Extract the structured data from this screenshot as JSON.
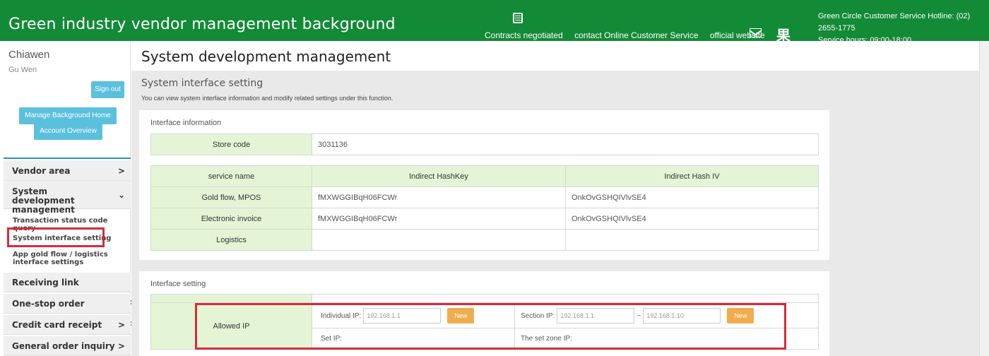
{
  "header": {
    "brand": "Green industry vendor management background",
    "nav": [
      "Contracts negotiated",
      "contact Online Customer Service",
      "official website"
    ],
    "hotline": "Green Circle Customer Service Hotline: (02) 2655-1775",
    "hours": "Service hours: 09:00-18:00",
    "glyph": "果",
    "icons": [
      "calendar-icon",
      "mail-icon"
    ],
    "bg_color": "#138a36"
  },
  "sidebar": {
    "user": "Chiawen",
    "user_sub": "Gu Wen",
    "sign_out": "Sign out",
    "manage_home": "Manage Background Home",
    "account_overview": "Account Overview",
    "menu": [
      {
        "label": "Vendor area",
        "chev": ">"
      },
      {
        "label": "System development management",
        "chev": "⌄"
      },
      {
        "label": "Receiving link management",
        "chev": ">"
      },
      {
        "label": "One-stop order management",
        "chev": ">"
      },
      {
        "label": "Credit card receipt",
        "chev": ">"
      },
      {
        "label": "General order inquiry",
        "chev": ">"
      }
    ],
    "sub_items": [
      "Transaction status code query",
      "System interface setting",
      "App gold flow / logistics interface settings"
    ]
  },
  "main": {
    "page_title": "System development management",
    "section_title": "System interface setting",
    "section_desc": "You can view system interface information and modify related settings under this function.",
    "interface_info": {
      "heading": "Interface information",
      "store_code_label": "Store code",
      "store_code": "3031136",
      "columns": [
        "service name",
        "Indirect HashKey",
        "Indirect Hash IV"
      ],
      "rows": [
        [
          "Gold flow, MPOS",
          "fMXWGGIBqH06FCWr",
          "OnkOvGSHQIVlvSE4"
        ],
        [
          "Electronic invoice",
          "fMXWGGIBqH06FCWr",
          "OnkOvGSHQIVlvSE4"
        ],
        [
          "Logistics",
          "",
          ""
        ]
      ]
    },
    "interface_setting": {
      "heading": "Interface setting",
      "allowed_ip": "Allowed IP",
      "individual_label": "Individual IP:",
      "individual_placeholder": "192.168.1.1",
      "new": "New",
      "section_label": "Section IP:",
      "section_from": "192.168.1.1",
      "tilde": "~",
      "section_to": "192.168.1.10",
      "set_ip": "Set IP:",
      "set_zone_ip": "The set zone IP:"
    }
  },
  "colors": {
    "accent_cyan": "#5bc0de",
    "orange": "#f0ad4e",
    "highlight_red": "#d62b3a",
    "label_green": "#e4f5d5"
  }
}
